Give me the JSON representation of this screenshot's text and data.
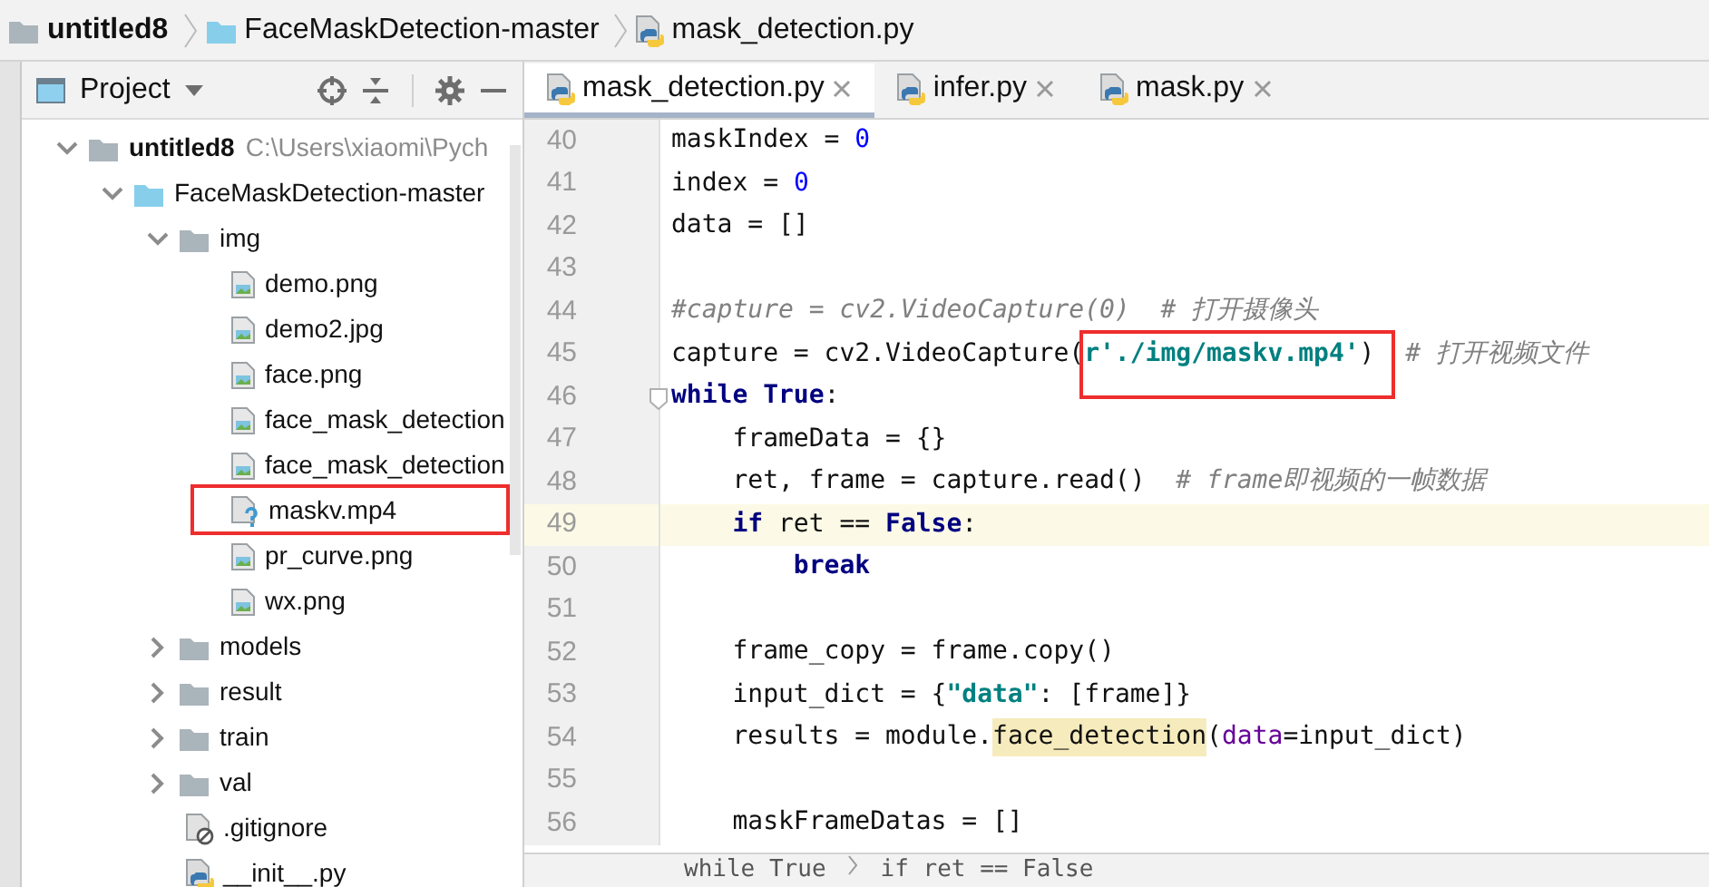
{
  "breadcrumb": [
    {
      "label": "untitled8",
      "kind": "project"
    },
    {
      "label": "FaceMaskDetection-master",
      "kind": "module"
    },
    {
      "label": "mask_detection.py",
      "kind": "python"
    }
  ],
  "project_panel": {
    "title": "Project",
    "tree": [
      {
        "label": "untitled8",
        "kind": "project",
        "expanded": true,
        "hint": "C:\\Users\\xiaomi\\Pych",
        "children": [
          {
            "label": "FaceMaskDetection-master",
            "kind": "module",
            "expanded": true,
            "children": [
              {
                "label": "img",
                "kind": "folder",
                "expanded": true,
                "children": [
                  {
                    "label": "demo.png",
                    "kind": "image"
                  },
                  {
                    "label": "demo2.jpg",
                    "kind": "image"
                  },
                  {
                    "label": "face.png",
                    "kind": "image"
                  },
                  {
                    "label": "face_mask_detection",
                    "kind": "image"
                  },
                  {
                    "label": "face_mask_detection",
                    "kind": "image"
                  },
                  {
                    "label": "maskv.mp4",
                    "kind": "unknown",
                    "marked": true
                  },
                  {
                    "label": "pr_curve.png",
                    "kind": "image"
                  },
                  {
                    "label": "wx.png",
                    "kind": "image"
                  }
                ]
              },
              {
                "label": "models",
                "kind": "folder",
                "expanded": false
              },
              {
                "label": "result",
                "kind": "folder",
                "expanded": false
              },
              {
                "label": "train",
                "kind": "folder",
                "expanded": false
              },
              {
                "label": "val",
                "kind": "folder",
                "expanded": false
              },
              {
                "label": ".gitignore",
                "kind": "ignored"
              },
              {
                "label": "__init__.py",
                "kind": "python"
              }
            ]
          }
        ]
      }
    ]
  },
  "tabs": [
    {
      "label": "mask_detection.py",
      "selected": true
    },
    {
      "label": "infer.py",
      "selected": false
    },
    {
      "label": "mask.py",
      "selected": false
    }
  ],
  "code": [
    {
      "number": "40",
      "segments": [
        {
          "text": "maskIndex = ",
          "kind": "text"
        },
        {
          "text": "0",
          "kind": "number"
        }
      ]
    },
    {
      "number": "41",
      "segments": [
        {
          "text": "index = ",
          "kind": "text"
        },
        {
          "text": "0",
          "kind": "number"
        }
      ]
    },
    {
      "number": "42",
      "segments": [
        {
          "text": "data = []",
          "kind": "text"
        }
      ]
    },
    {
      "number": "43"
    },
    {
      "number": "44",
      "segments": [
        {
          "text": "#capture = cv2.VideoCapture(0)  # 打开摄像头",
          "kind": "comment"
        }
      ]
    },
    {
      "number": "45",
      "segments": [
        {
          "text": "capture = cv2.VideoCapture(",
          "kind": "text"
        },
        {
          "text": "r'./img/maskv.mp4'",
          "kind": "string",
          "marked": true
        },
        {
          "text": ")  ",
          "kind": "text"
        },
        {
          "text": "# 打开视频文件",
          "kind": "comment"
        }
      ]
    },
    {
      "number": "46",
      "fold": true,
      "segments": [
        {
          "text": "while True",
          "kind": "keyword"
        },
        {
          "text": ":",
          "kind": "text"
        }
      ]
    },
    {
      "number": "47",
      "segments": [
        {
          "text": "    frameData = {}",
          "kind": "text"
        }
      ]
    },
    {
      "number": "48",
      "segments": [
        {
          "text": "    ret, frame = capture.read()  ",
          "kind": "text"
        },
        {
          "text": "# frame即视频的一帧数据",
          "kind": "comment"
        }
      ]
    },
    {
      "number": "49",
      "current": true,
      "segments": [
        {
          "text": "    if",
          "kind": "keyword"
        },
        {
          "text": " ret == ",
          "kind": "text"
        },
        {
          "text": "False",
          "kind": "keyword"
        },
        {
          "text": ":",
          "kind": "text"
        }
      ]
    },
    {
      "number": "50",
      "segments": [
        {
          "text": "        break",
          "kind": "keyword"
        }
      ]
    },
    {
      "number": "51"
    },
    {
      "number": "52",
      "segments": [
        {
          "text": "    frame_copy = frame.copy()",
          "kind": "text"
        }
      ]
    },
    {
      "number": "53",
      "segments": [
        {
          "text": "    input_dict = {",
          "kind": "text"
        },
        {
          "text": "\"data\"",
          "kind": "string"
        },
        {
          "text": ": [frame]}",
          "kind": "text"
        }
      ]
    },
    {
      "number": "54",
      "segments": [
        {
          "text": "    results = module.",
          "kind": "text"
        },
        {
          "text": "face_detection",
          "kind": "usage"
        },
        {
          "text": "(",
          "kind": "text"
        },
        {
          "text": "data",
          "kind": "param"
        },
        {
          "text": "=input_dict)",
          "kind": "text"
        }
      ]
    },
    {
      "number": "55"
    },
    {
      "number": "56",
      "segments": [
        {
          "text": "    maskFrameDatas = []",
          "kind": "text"
        }
      ]
    }
  ],
  "status_breadcrumb": [
    "while True",
    "if ret == False"
  ]
}
